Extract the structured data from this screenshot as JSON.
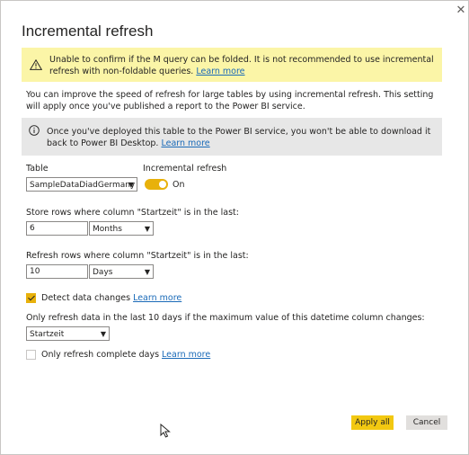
{
  "dialog": {
    "title": "Incremental refresh",
    "close_glyph": "✕"
  },
  "warning": {
    "icon": "warning-icon",
    "text": "Unable to confirm if the M query can be folded. It is not recommended to use incremental refresh with non-foldable queries.",
    "link": "Learn more",
    "background": "#fbf5a7"
  },
  "description": "You can improve the speed of refresh for large tables by using incremental refresh. This setting will apply once you've published a report to the Power BI service.",
  "info": {
    "icon": "info-icon",
    "text": "Once you've deployed this table to the Power BI service, you won't be able to download it back to Power BI Desktop.",
    "link": "Learn more",
    "background": "#e7e7e7"
  },
  "table": {
    "label": "Table",
    "value": "SampleDataDiadGermany"
  },
  "incremental": {
    "label": "Incremental refresh",
    "state_label": "On",
    "accent": "#e8b10b"
  },
  "store": {
    "label": "Store rows where column \"Startzeit\" is in the last:",
    "value": "6",
    "unit": "Months"
  },
  "refresh": {
    "label": "Refresh rows where column \"Startzeit\" is in the last:",
    "value": "10",
    "unit": "Days"
  },
  "detect": {
    "label": "Detect data changes",
    "link": "Learn more",
    "checked": true
  },
  "detect_column": {
    "label": "Only refresh data in the last 10 days if the maximum value of this datetime column changes:",
    "value": "Startzeit"
  },
  "complete_days": {
    "label": "Only refresh complete days",
    "link": "Learn more",
    "checked": false
  },
  "buttons": {
    "apply": "Apply all",
    "cancel": "Cancel"
  },
  "dropdown_glyph": "▼"
}
